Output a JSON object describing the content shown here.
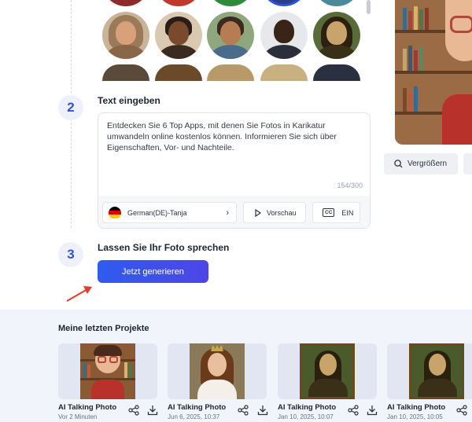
{
  "steps": {
    "step2": {
      "number": "2",
      "title": "Text eingeben"
    },
    "step3": {
      "number": "3",
      "title": "Lassen Sie Ihr Foto sprechen"
    }
  },
  "text_input": {
    "value": "Entdecken Sie 6 Top Apps, mit denen Sie Fotos in Karikatur umwandeln online kostenlos können. Informieren Sie sich über Eigenschaften, Vor- und Nachteile.",
    "counter": "154/300"
  },
  "voice": {
    "label": "German(DE)-Tanja"
  },
  "preview_btn": {
    "label": "Vorschau"
  },
  "captions_btn": {
    "label": "EIN",
    "icon_text": "CC"
  },
  "generate_btn": {
    "label": "Jetzt generieren"
  },
  "zoom_btn": {
    "label": "Vergrößern"
  },
  "projects": {
    "title": "Meine letzten Projekte",
    "items": [
      {
        "name": "AI Talking Photo",
        "date": "Vor 2 Minuten"
      },
      {
        "name": "AI Talking Photo",
        "date": "Jun 6, 2025, 10:37"
      },
      {
        "name": "AI Talking Photo",
        "date": "Jan 10, 2025, 10:07"
      },
      {
        "name": "AI Talking Photo",
        "date": "Jan 10, 2025, 10:05"
      }
    ]
  },
  "colors": {
    "accent": "#2f55d4",
    "button_start": "#2f5bf0",
    "button_end": "#4e45e6",
    "projects_bg": "#f1f4fb"
  }
}
